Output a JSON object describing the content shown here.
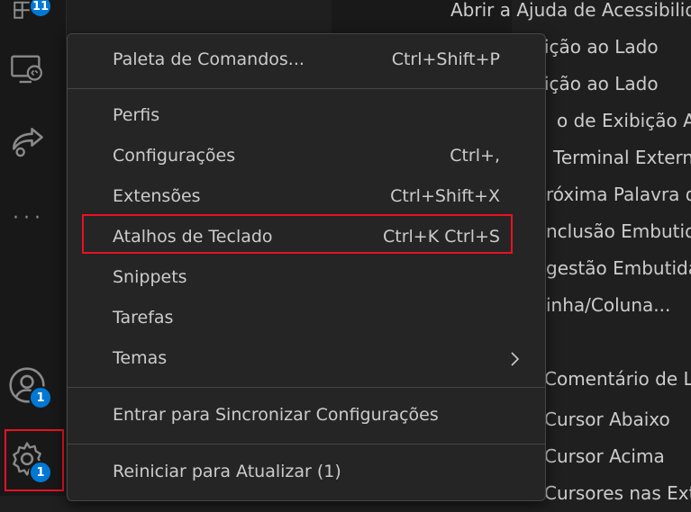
{
  "activity_bar": {
    "extensions_badge": "11",
    "accounts_badge": "1",
    "manage_badge": "1"
  },
  "background_list": [
    "Abrir a Ajuda de Acessibilid",
    "ição ao Lado",
    "ição ao Lado",
    "o de Exibição Ace",
    "Terminal Extern",
    "róxima Palavra d",
    "nclusão Embutid",
    "gestão Embutida",
    "inha/Coluna...",
    "",
    "Comentário de Li",
    "Cursor Abaixo",
    "Cursor Acima",
    "Cursores nas Extr"
  ],
  "menu": {
    "items": [
      {
        "label": "Paleta de Comandos...",
        "shortcut": "Ctrl+Shift+P"
      },
      {
        "label": "Perfis",
        "shortcut": ""
      },
      {
        "label": "Configurações",
        "shortcut": "Ctrl+,"
      },
      {
        "label": "Extensões",
        "shortcut": "Ctrl+Shift+X"
      },
      {
        "label": "Atalhos de Teclado",
        "shortcut": "Ctrl+K Ctrl+S"
      },
      {
        "label": "Snippets",
        "shortcut": ""
      },
      {
        "label": "Tarefas",
        "shortcut": ""
      },
      {
        "label": "Temas",
        "shortcut": ""
      },
      {
        "label": "Entrar para Sincronizar Configurações",
        "shortcut": ""
      },
      {
        "label": "Reiniciar para Atualizar (1)",
        "shortcut": ""
      }
    ]
  },
  "colors": {
    "accent": "#0078d4",
    "highlight": "#e81123",
    "menu_bg": "#252526"
  }
}
